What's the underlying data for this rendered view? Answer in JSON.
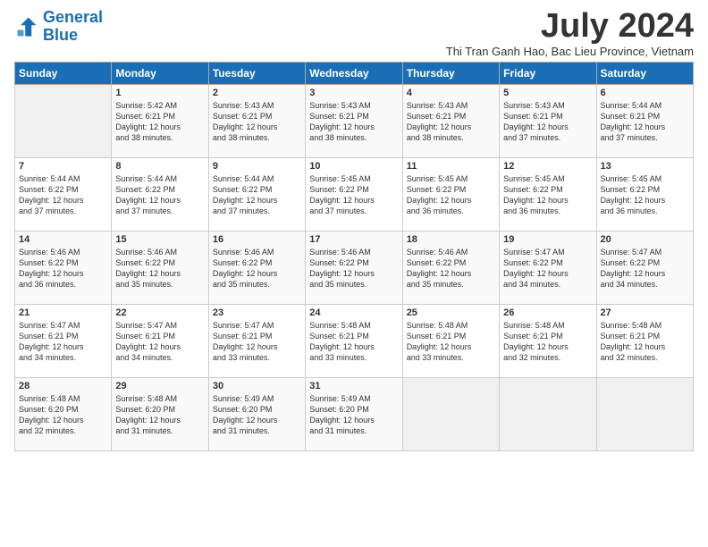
{
  "logo": {
    "line1": "General",
    "line2": "Blue"
  },
  "title": "July 2024",
  "subtitle": "Thi Tran Ganh Hao, Bac Lieu Province, Vietnam",
  "headers": [
    "Sunday",
    "Monday",
    "Tuesday",
    "Wednesday",
    "Thursday",
    "Friday",
    "Saturday"
  ],
  "weeks": [
    [
      {
        "num": "",
        "info": ""
      },
      {
        "num": "1",
        "info": "Sunrise: 5:42 AM\nSunset: 6:21 PM\nDaylight: 12 hours\nand 38 minutes."
      },
      {
        "num": "2",
        "info": "Sunrise: 5:43 AM\nSunset: 6:21 PM\nDaylight: 12 hours\nand 38 minutes."
      },
      {
        "num": "3",
        "info": "Sunrise: 5:43 AM\nSunset: 6:21 PM\nDaylight: 12 hours\nand 38 minutes."
      },
      {
        "num": "4",
        "info": "Sunrise: 5:43 AM\nSunset: 6:21 PM\nDaylight: 12 hours\nand 38 minutes."
      },
      {
        "num": "5",
        "info": "Sunrise: 5:43 AM\nSunset: 6:21 PM\nDaylight: 12 hours\nand 37 minutes."
      },
      {
        "num": "6",
        "info": "Sunrise: 5:44 AM\nSunset: 6:21 PM\nDaylight: 12 hours\nand 37 minutes."
      }
    ],
    [
      {
        "num": "7",
        "info": "Sunrise: 5:44 AM\nSunset: 6:22 PM\nDaylight: 12 hours\nand 37 minutes."
      },
      {
        "num": "8",
        "info": "Sunrise: 5:44 AM\nSunset: 6:22 PM\nDaylight: 12 hours\nand 37 minutes."
      },
      {
        "num": "9",
        "info": "Sunrise: 5:44 AM\nSunset: 6:22 PM\nDaylight: 12 hours\nand 37 minutes."
      },
      {
        "num": "10",
        "info": "Sunrise: 5:45 AM\nSunset: 6:22 PM\nDaylight: 12 hours\nand 37 minutes."
      },
      {
        "num": "11",
        "info": "Sunrise: 5:45 AM\nSunset: 6:22 PM\nDaylight: 12 hours\nand 36 minutes."
      },
      {
        "num": "12",
        "info": "Sunrise: 5:45 AM\nSunset: 6:22 PM\nDaylight: 12 hours\nand 36 minutes."
      },
      {
        "num": "13",
        "info": "Sunrise: 5:45 AM\nSunset: 6:22 PM\nDaylight: 12 hours\nand 36 minutes."
      }
    ],
    [
      {
        "num": "14",
        "info": "Sunrise: 5:46 AM\nSunset: 6:22 PM\nDaylight: 12 hours\nand 36 minutes."
      },
      {
        "num": "15",
        "info": "Sunrise: 5:46 AM\nSunset: 6:22 PM\nDaylight: 12 hours\nand 35 minutes."
      },
      {
        "num": "16",
        "info": "Sunrise: 5:46 AM\nSunset: 6:22 PM\nDaylight: 12 hours\nand 35 minutes."
      },
      {
        "num": "17",
        "info": "Sunrise: 5:46 AM\nSunset: 6:22 PM\nDaylight: 12 hours\nand 35 minutes."
      },
      {
        "num": "18",
        "info": "Sunrise: 5:46 AM\nSunset: 6:22 PM\nDaylight: 12 hours\nand 35 minutes."
      },
      {
        "num": "19",
        "info": "Sunrise: 5:47 AM\nSunset: 6:22 PM\nDaylight: 12 hours\nand 34 minutes."
      },
      {
        "num": "20",
        "info": "Sunrise: 5:47 AM\nSunset: 6:22 PM\nDaylight: 12 hours\nand 34 minutes."
      }
    ],
    [
      {
        "num": "21",
        "info": "Sunrise: 5:47 AM\nSunset: 6:21 PM\nDaylight: 12 hours\nand 34 minutes."
      },
      {
        "num": "22",
        "info": "Sunrise: 5:47 AM\nSunset: 6:21 PM\nDaylight: 12 hours\nand 34 minutes."
      },
      {
        "num": "23",
        "info": "Sunrise: 5:47 AM\nSunset: 6:21 PM\nDaylight: 12 hours\nand 33 minutes."
      },
      {
        "num": "24",
        "info": "Sunrise: 5:48 AM\nSunset: 6:21 PM\nDaylight: 12 hours\nand 33 minutes."
      },
      {
        "num": "25",
        "info": "Sunrise: 5:48 AM\nSunset: 6:21 PM\nDaylight: 12 hours\nand 33 minutes."
      },
      {
        "num": "26",
        "info": "Sunrise: 5:48 AM\nSunset: 6:21 PM\nDaylight: 12 hours\nand 32 minutes."
      },
      {
        "num": "27",
        "info": "Sunrise: 5:48 AM\nSunset: 6:21 PM\nDaylight: 12 hours\nand 32 minutes."
      }
    ],
    [
      {
        "num": "28",
        "info": "Sunrise: 5:48 AM\nSunset: 6:20 PM\nDaylight: 12 hours\nand 32 minutes."
      },
      {
        "num": "29",
        "info": "Sunrise: 5:48 AM\nSunset: 6:20 PM\nDaylight: 12 hours\nand 31 minutes."
      },
      {
        "num": "30",
        "info": "Sunrise: 5:49 AM\nSunset: 6:20 PM\nDaylight: 12 hours\nand 31 minutes."
      },
      {
        "num": "31",
        "info": "Sunrise: 5:49 AM\nSunset: 6:20 PM\nDaylight: 12 hours\nand 31 minutes."
      },
      {
        "num": "",
        "info": ""
      },
      {
        "num": "",
        "info": ""
      },
      {
        "num": "",
        "info": ""
      }
    ]
  ]
}
